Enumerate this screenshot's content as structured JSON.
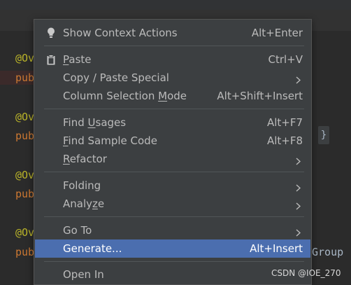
{
  "editor": {
    "lines": [
      {
        "annotation": "@Ov",
        "keyword": "pub"
      },
      {
        "annotation": "@Ov",
        "keyword": "pub"
      },
      {
        "annotation": "@Ov",
        "keyword": "pub"
      },
      {
        "annotation": "@Ov",
        "keyword": "pub"
      }
    ],
    "brace": "}",
    "fragment_group": "Group"
  },
  "context_menu": {
    "items": [
      {
        "pre": "",
        "mn": "",
        "post": "Show Context Actions",
        "shortcut": "Alt+Enter",
        "icon": "lightbulb-icon"
      },
      {
        "pre": "",
        "mn": "P",
        "post": "aste",
        "shortcut": "Ctrl+V",
        "icon": "clipboard-icon"
      },
      {
        "pre": "Copy / Paste Special",
        "mn": "",
        "post": "",
        "submenu": true
      },
      {
        "pre": "Column Selection ",
        "mn": "M",
        "post": "ode",
        "shortcut": "Alt+Shift+Insert"
      },
      {
        "pre": "Find ",
        "mn": "U",
        "post": "sages",
        "shortcut": "Alt+F7"
      },
      {
        "pre": "",
        "mn": "F",
        "post": "ind Sample Code",
        "shortcut": "Alt+F8"
      },
      {
        "pre": "",
        "mn": "R",
        "post": "efactor",
        "submenu": true
      },
      {
        "pre": "Folding",
        "mn": "",
        "post": "",
        "submenu": true
      },
      {
        "pre": "Analy",
        "mn": "z",
        "post": "e",
        "submenu": true
      },
      {
        "pre": "Go To",
        "mn": "",
        "post": "",
        "submenu": true
      },
      {
        "pre": "Generate...",
        "mn": "",
        "post": "",
        "shortcut": "Alt+Insert",
        "selected": true
      },
      {
        "pre": "Open In",
        "mn": "",
        "post": "",
        "submenu": true
      }
    ],
    "selected_color": "#4b6eaf",
    "background_color": "#3c3f41"
  },
  "watermark": "CSDN @IOE_270"
}
